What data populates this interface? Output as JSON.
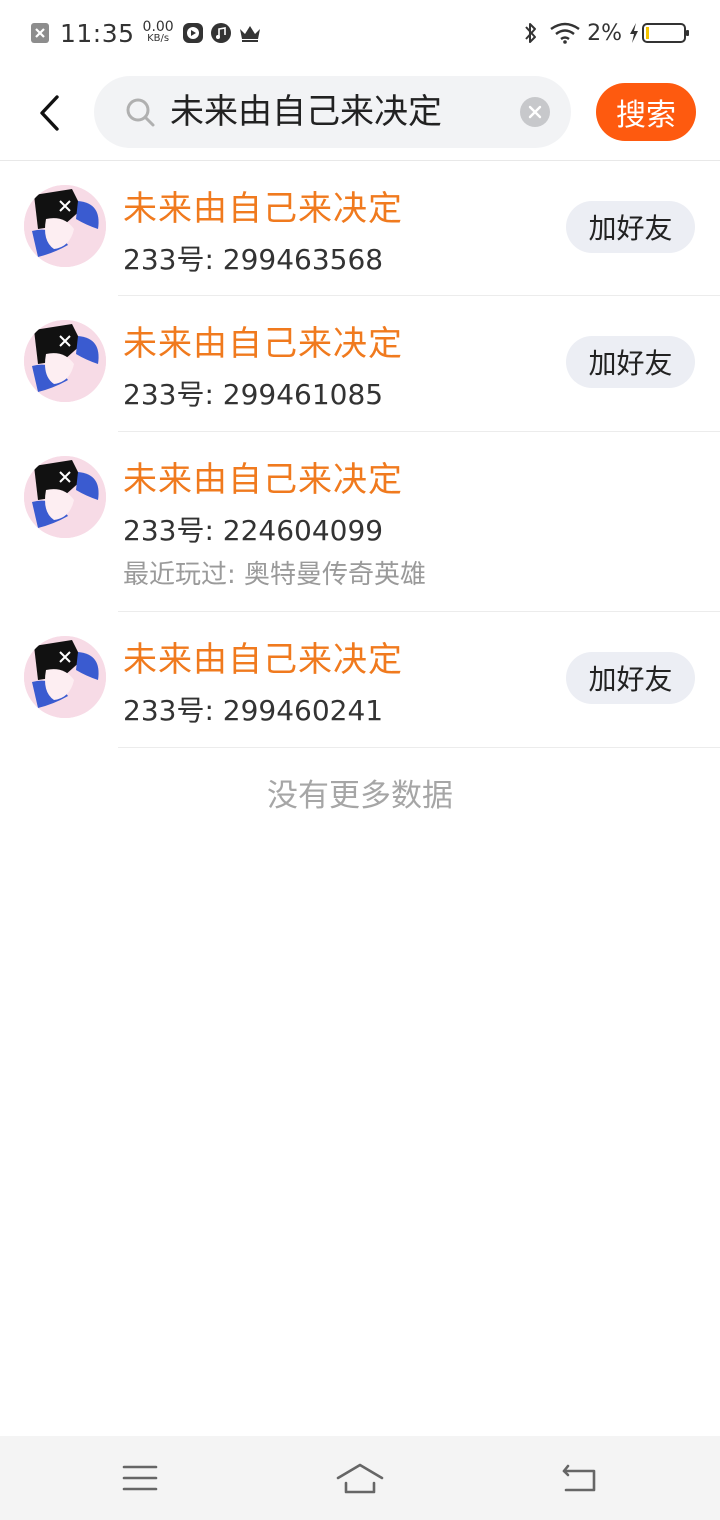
{
  "status_bar": {
    "time": "11:35",
    "speed_value": "0.00",
    "speed_unit": "KB/s",
    "battery": "2%"
  },
  "search": {
    "query": "未来由自己来决定",
    "button_label": "搜索"
  },
  "results": [
    {
      "name": "未来由自己来决定",
      "id": "233号: 299463568",
      "action": "加好友"
    },
    {
      "name": "未来由自己来决定",
      "id": "233号: 299461085",
      "action": "加好友"
    },
    {
      "name": "未来由自己来决定",
      "id": "233号: 224604099",
      "played": "最近玩过: 奥特曼传奇英雄"
    },
    {
      "name": "未来由自己来决定",
      "id": "233号: 299460241",
      "action": "加好友"
    }
  ],
  "footer_text": "没有更多数据",
  "colors": {
    "accent": "#fe5a0f",
    "name_orange": "#f07a1e",
    "chip_bg": "#eceef4"
  },
  "icons": [
    "close-box-icon",
    "play-icon",
    "music-icon",
    "crown-icon",
    "bluetooth-icon",
    "wifi-icon",
    "charging-icon",
    "battery-icon",
    "back-arrow-icon",
    "search-icon",
    "clear-icon",
    "menu-icon",
    "home-icon",
    "return-icon"
  ]
}
